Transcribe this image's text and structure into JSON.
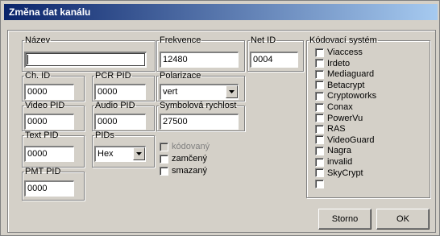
{
  "window": {
    "title": "Změna dat kanálu"
  },
  "fields": {
    "nazev": {
      "label": "Název",
      "value": ""
    },
    "frekvence": {
      "label": "Frekvence",
      "value": "12480"
    },
    "net_id": {
      "label": "Net ID",
      "value": "0004"
    },
    "ch_id": {
      "label": "Ch. ID",
      "value": "0000"
    },
    "pcr_pid": {
      "label": "PCR PID",
      "value": "0000"
    },
    "polarizace": {
      "label": "Polarizace",
      "value": "vert"
    },
    "video_pid": {
      "label": "Video PID",
      "value": "0000"
    },
    "audio_pid": {
      "label": "Audio PID",
      "value": "0000"
    },
    "symbolova": {
      "label": "Symbolová rychlost",
      "value": "27500"
    },
    "text_pid": {
      "label": "Text PID",
      "value": "0000"
    },
    "pids": {
      "label": "PIDs",
      "value": "Hex"
    },
    "pmt_pid": {
      "label": "PMT PID",
      "value": "0000"
    }
  },
  "flags": [
    {
      "label": "kódovaný",
      "checked": false,
      "disabled": true
    },
    {
      "label": "zamčený",
      "checked": false,
      "disabled": false
    },
    {
      "label": "smazaný",
      "checked": false,
      "disabled": false
    }
  ],
  "encryption": {
    "label": "Kódovací systém",
    "items": [
      "Viaccess",
      "Irdeto",
      "Mediaguard",
      "Betacrypt",
      "Cryptoworks",
      "Conax",
      "PowerVu",
      "RAS",
      "VideoGuard",
      "Nagra",
      "invalid",
      "SkyCrypt",
      ""
    ]
  },
  "buttons": {
    "cancel": "Storno",
    "ok": "OK"
  },
  "icons": {
    "dropdown": "chevron-down-icon"
  }
}
